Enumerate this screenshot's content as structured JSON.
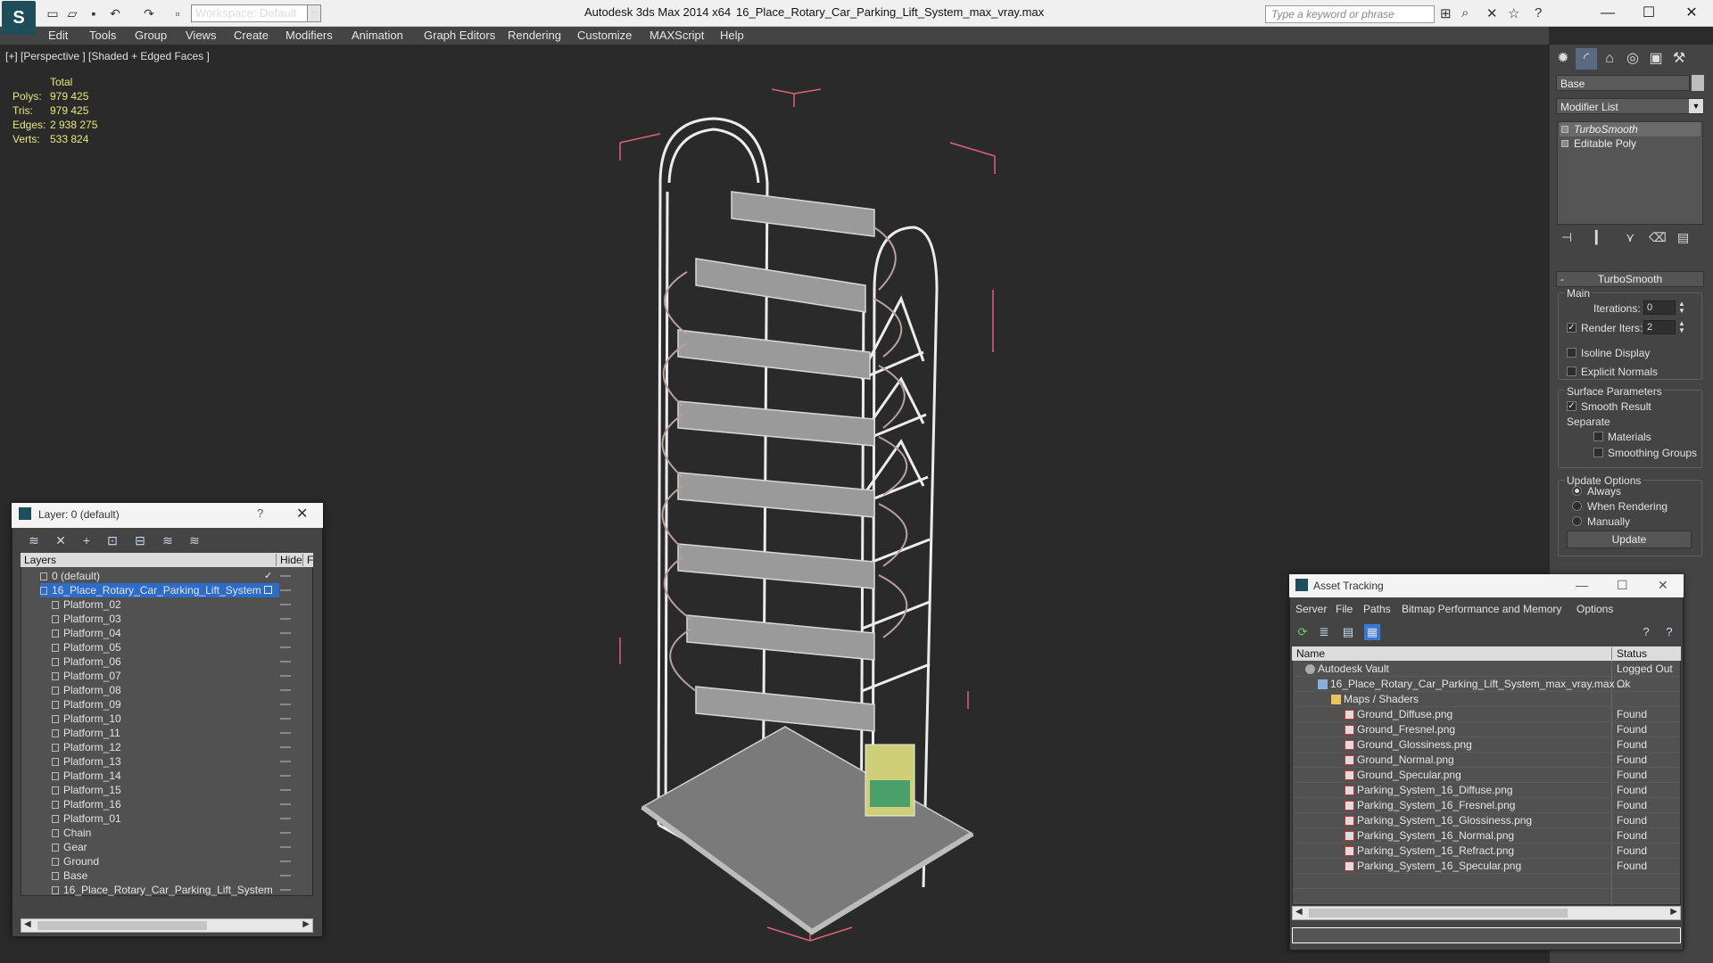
{
  "titlebar": {
    "workspace": "Workspace: Default",
    "app_title": "Autodesk 3ds Max  2014 x64",
    "doc_title": "16_Place_Rotary_Car_Parking_Lift_System_max_vray.max",
    "search_placeholder": "Type a keyword or phrase"
  },
  "menu": [
    "Edit",
    "Tools",
    "Group",
    "Views",
    "Create",
    "Modifiers",
    "Animation",
    "Graph Editors",
    "Rendering",
    "Customize",
    "MAXScript",
    "Help"
  ],
  "viewport": {
    "label": "[+] [Perspective ] [Shaded + Edged Faces ]",
    "stats": {
      "header": "Total",
      "polys_label": "Polys:",
      "polys": "979 425",
      "tris_label": "Tris:",
      "tris": "979 425",
      "edges_label": "Edges:",
      "edges": "2 938 275",
      "verts_label": "Verts:",
      "verts": "533 824"
    }
  },
  "command_panel": {
    "object_name": "Base",
    "modifier_list": "Modifier List",
    "stack": [
      "TurboSmooth",
      "Editable Poly"
    ],
    "rollout_title": "TurboSmooth",
    "main_group": "Main",
    "iterations_label": "Iterations:",
    "iterations_value": "0",
    "render_iters_label": "Render Iters:",
    "render_iters_value": "2",
    "isoline_label": "Isoline Display",
    "explicit_normals_label": "Explicit Normals",
    "surface_group": "Surface Parameters",
    "smooth_result_label": "Smooth Result",
    "separate_label": "Separate",
    "materials_label": "Materials",
    "smoothing_groups_label": "Smoothing Groups",
    "update_group": "Update Options",
    "always_label": "Always",
    "when_rendering_label": "When Rendering",
    "manually_label": "Manually",
    "update_button": "Update"
  },
  "layer_dialog": {
    "title": "Layer: 0 (default)",
    "help": "?",
    "col_layers": "Layers",
    "col_hide": "Hide",
    "col_f": "F",
    "rows": [
      {
        "name": "0 (default)",
        "level": 1
      },
      {
        "name": "16_Place_Rotary_Car_Parking_Lift_System",
        "level": 1
      },
      {
        "name": "Platform_02",
        "level": 2
      },
      {
        "name": "Platform_03",
        "level": 2
      },
      {
        "name": "Platform_04",
        "level": 2
      },
      {
        "name": "Platform_05",
        "level": 2
      },
      {
        "name": "Platform_06",
        "level": 2
      },
      {
        "name": "Platform_07",
        "level": 2
      },
      {
        "name": "Platform_08",
        "level": 2
      },
      {
        "name": "Platform_09",
        "level": 2
      },
      {
        "name": "Platform_10",
        "level": 2
      },
      {
        "name": "Platform_11",
        "level": 2
      },
      {
        "name": "Platform_12",
        "level": 2
      },
      {
        "name": "Platform_13",
        "level": 2
      },
      {
        "name": "Platform_14",
        "level": 2
      },
      {
        "name": "Platform_15",
        "level": 2
      },
      {
        "name": "Platform_16",
        "level": 2
      },
      {
        "name": "Platform_01",
        "level": 2
      },
      {
        "name": "Chain",
        "level": 2
      },
      {
        "name": "Gear",
        "level": 2
      },
      {
        "name": "Ground",
        "level": 2
      },
      {
        "name": "Base",
        "level": 2
      },
      {
        "name": "16_Place_Rotary_Car_Parking_Lift_System",
        "level": 2
      }
    ]
  },
  "asset_tracking": {
    "title": "Asset Tracking",
    "menu": [
      "Server",
      "File",
      "Paths",
      "Bitmap Performance and Memory",
      "Options"
    ],
    "col_name": "Name",
    "col_status": "Status",
    "rows": [
      {
        "name": "Autodesk Vault",
        "status": "Logged Out ...",
        "icon": "vault"
      },
      {
        "name": "16_Place_Rotary_Car_Parking_Lift_System_max_vray.max",
        "status": "Ok",
        "icon": "file"
      },
      {
        "name": "Maps / Shaders",
        "status": "",
        "icon": "folder"
      },
      {
        "name": "Ground_Diffuse.png",
        "status": "Found",
        "icon": "png"
      },
      {
        "name": "Ground_Fresnel.png",
        "status": "Found",
        "icon": "png"
      },
      {
        "name": "Ground_Glossiness.png",
        "status": "Found",
        "icon": "png"
      },
      {
        "name": "Ground_Normal.png",
        "status": "Found",
        "icon": "png"
      },
      {
        "name": "Ground_Specular.png",
        "status": "Found",
        "icon": "png"
      },
      {
        "name": "Parking_System_16_Diffuse.png",
        "status": "Found",
        "icon": "png"
      },
      {
        "name": "Parking_System_16_Fresnel.png",
        "status": "Found",
        "icon": "png"
      },
      {
        "name": "Parking_System_16_Glossiness.png",
        "status": "Found",
        "icon": "png"
      },
      {
        "name": "Parking_System_16_Normal.png",
        "status": "Found",
        "icon": "png"
      },
      {
        "name": "Parking_System_16_Refract.png",
        "status": "Found",
        "icon": "png"
      },
      {
        "name": "Parking_System_16_Specular.png",
        "status": "Found",
        "icon": "png"
      }
    ]
  },
  "colors": {
    "accent": "#2d6cc9",
    "stats_text": "#e8e87a",
    "bounding_box": "#e0607a"
  }
}
